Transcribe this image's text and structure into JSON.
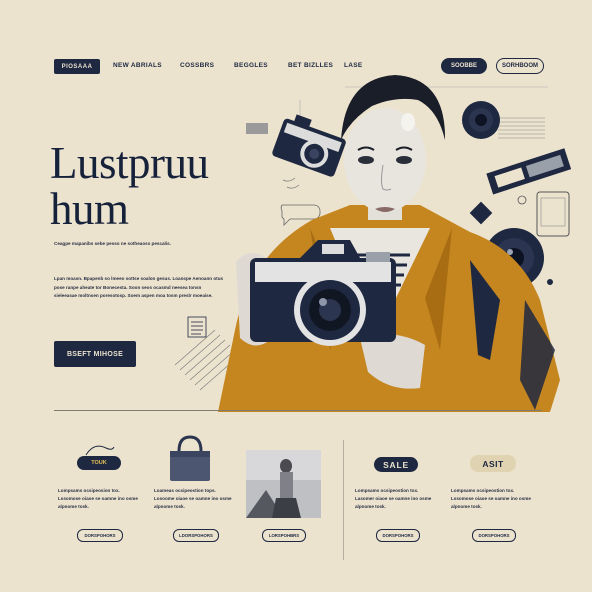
{
  "nav": {
    "primary_label": "PIOSAAA",
    "links": [
      "NEW ABRIALS",
      "COSSBRS",
      "BEGGLES",
      "BET BIZLLES",
      "LASE"
    ],
    "pill_dark_label": "SOOBBE",
    "pill_outline_label": "SORHBOOM"
  },
  "hero": {
    "title_line1": "Lustpruu",
    "title_line2": "hum",
    "subtitle": "Ceagpe mapanibs sebe pesso ne sotheaoss pescalis.",
    "body": "Lpan moasn. Bpapenb so lmeeo sottse soalon gesus. Loanspe Aenoann otus pose ranpe aheate tor Bonecesta. Soon seos ocasmd neesea tonsn sieleeasae moltnsen poresotosp. Soem aspen moa tosm preslr moeaise.",
    "cta_label": "BSEFT MIHOSE"
  },
  "products": {
    "nav_tag": "TOUK",
    "sale_tag": "SALE",
    "asit_tag": "ASIT",
    "card_texts": [
      "Lompsams ocsipeosion tox. Lssomose oiaoe se oamne ino osme alpnome tosk.",
      "Loameas ocsipeostion tops. Losoome oiaoe se oamne ino osme alpnome tosk.",
      "Lompsams ocsipeostion tox. Lasomer oiaoe se oamne ino osme alpnome tosk.",
      "Lompsams ocsipeostion tox. Lssomose oiaoe se oamne ino osme alpnome tosk."
    ],
    "card_buttons": [
      "DORSPOHORS",
      "LDORSPOHORS",
      "LORSPOHBRS",
      "DORSPOHORS",
      "DORSPOHORS"
    ]
  },
  "colors": {
    "background": "#ece3cf",
    "navy": "#1e2840",
    "mustard": "#c5861f"
  }
}
